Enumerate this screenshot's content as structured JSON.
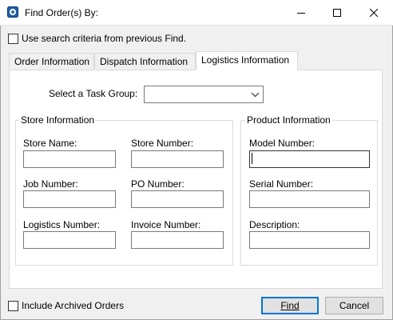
{
  "window": {
    "title": "Find Order(s) By:"
  },
  "options": {
    "use_previous_label": "Use search criteria from previous Find.",
    "use_previous_checked": false,
    "include_archived_label": "Include Archived Orders",
    "include_archived_checked": false
  },
  "tabs": [
    {
      "label": "Order Information",
      "active": false
    },
    {
      "label": "Dispatch Information",
      "active": false
    },
    {
      "label": "Logistics Information",
      "active": true
    }
  ],
  "task_group": {
    "label": "Select a Task Group:",
    "value": ""
  },
  "store_info": {
    "legend": "Store Information",
    "fields": [
      {
        "label": "Store Name:",
        "value": ""
      },
      {
        "label": "Store Number:",
        "value": ""
      },
      {
        "label": "Job Number:",
        "value": ""
      },
      {
        "label": "PO Number:",
        "value": ""
      },
      {
        "label": "Logistics Number:",
        "value": ""
      },
      {
        "label": "Invoice Number:",
        "value": ""
      }
    ]
  },
  "product_info": {
    "legend": "Product Information",
    "fields": [
      {
        "label": "Model Number:",
        "value": ""
      },
      {
        "label": "Serial Number:",
        "value": ""
      },
      {
        "label": "Description:",
        "value": ""
      }
    ]
  },
  "buttons": {
    "find_label": "Find",
    "cancel_label": "Cancel"
  },
  "icons": {
    "app": "app-icon",
    "minimize": "minimize-icon",
    "maximize": "maximize-icon",
    "close": "close-icon",
    "dropdown": "chevron-down-icon"
  },
  "colors": {
    "focus_border": "#0078d7",
    "app_icon_blue": "#1f5fa8"
  }
}
